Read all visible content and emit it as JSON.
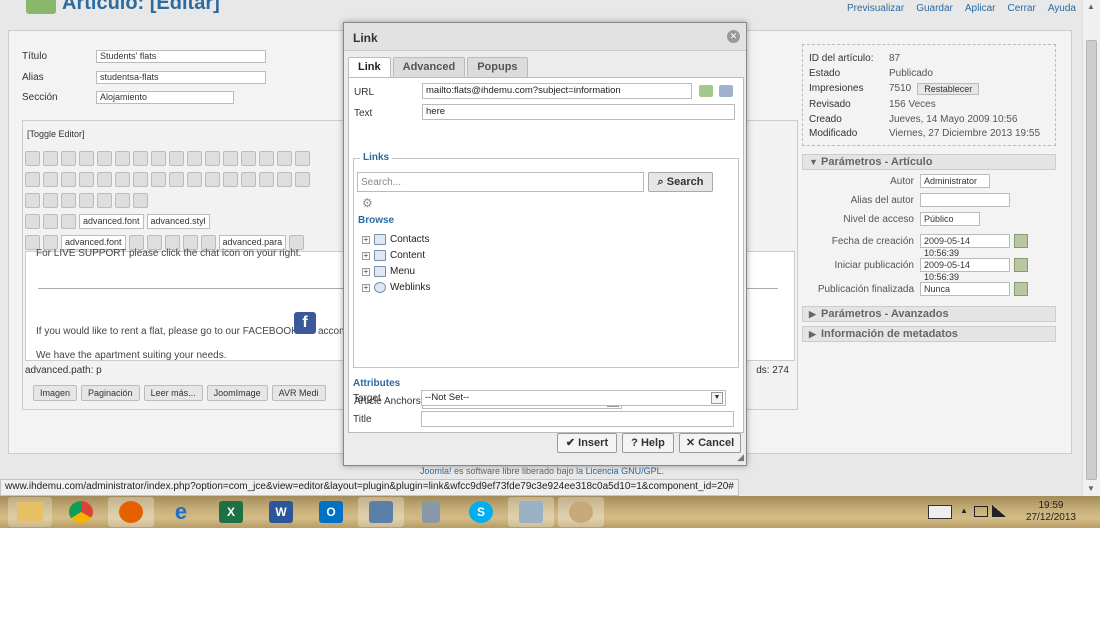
{
  "page": {
    "title": "Artículo: [Editar]"
  },
  "top_actions": [
    "Previsualizar",
    "Guardar",
    "Aplicar",
    "Cerrar",
    "Ayuda"
  ],
  "form": {
    "titulo_label": "Título",
    "titulo_value": "Students' flats",
    "alias_label": "Alias",
    "alias_value": "studentsa-flats",
    "seccion_label": "Sección",
    "seccion_value": "Alojamiento"
  },
  "editor": {
    "toggle_label": "[Toggle Editor]",
    "font_select": "advanced.font",
    "style_select": "advanced.styl",
    "font_select2": "advanced.font",
    "para_select": "advanced.para",
    "line1": "For LIVE SUPPORT please click the chat icon on your right.",
    "line2": "If you would like to rent a flat, please go to our FACEBOOK",
    "line2_tail": "accom",
    "line3": "We have the apartment suiting your needs.",
    "path": "advanced.path: p",
    "word_count": "ds: 274",
    "bottom_buttons": [
      "Imagen",
      "Paginación",
      "Leer más...",
      "JoomImage",
      "AVR Medi"
    ]
  },
  "info": {
    "rows": [
      {
        "k": "ID del artículo:",
        "v": "87"
      },
      {
        "k": "Estado",
        "v": "Publicado"
      },
      {
        "k": "Impresiones",
        "v": "7510"
      },
      {
        "k": "Revisado",
        "v": "156 Veces"
      },
      {
        "k": "Creado",
        "v": "Jueves, 14 Mayo 2009 10:56"
      },
      {
        "k": "Modificado",
        "v": "Viernes, 27 Diciembre 2013 19:55"
      }
    ],
    "reset_label": "Restablecer"
  },
  "params": {
    "header": "Parámetros - Artículo",
    "rows": [
      {
        "k": "Autor",
        "v": "Administrator"
      },
      {
        "k": "Alias del autor",
        "v": ""
      },
      {
        "k": "Nivel de acceso",
        "v": "Público"
      },
      {
        "k": "Fecha de creación",
        "v": "2009-05-14 10:56:39"
      },
      {
        "k": "Iniciar publicación",
        "v": "2009-05-14 10:56:39"
      },
      {
        "k": "Publicación finalizada",
        "v": "Nunca"
      }
    ],
    "advanced_header": "Parámetros - Avanzados",
    "meta_header": "Información de metadatos"
  },
  "footer": {
    "brand": "Joomla!",
    "text": " es software libre liberado bajo la ",
    "license": "Licencia GNU/GPL."
  },
  "status_url": "www.ihdemu.com/administrator/index.php?option=com_jce&view=editor&layout=plugin&plugin=link&wfcc9d9ef73fde79c3e924ee318c0a5d10=1&component_id=20#",
  "dialog": {
    "title": "Link",
    "tabs": [
      "Link",
      "Advanced",
      "Popups"
    ],
    "url_label": "URL",
    "url_value": "mailto:flats@ihdemu.com?subject=information",
    "text_label": "Text",
    "text_value": "here",
    "links_legend": "Links",
    "search_placeholder": "Search...",
    "search_button": "Search",
    "browse_label": "Browse",
    "tree": [
      "Contacts",
      "Content",
      "Menu",
      "Weblinks"
    ],
    "attributes_label": "Attributes",
    "anchors_label": "Article Anchors",
    "anchors_value": "---",
    "target_label": "Target",
    "target_value": "--Not Set--",
    "title_label": "Title",
    "title_value": "",
    "insert": "Insert",
    "help": "Help",
    "cancel": "Cancel"
  },
  "taskbar": {
    "time": "19:59",
    "date": "27/12/2013",
    "apps": [
      "explorer",
      "chrome",
      "firefox",
      "internet-explorer",
      "excel",
      "word",
      "outlook",
      "remote-desktop",
      "calculator",
      "skype",
      "app",
      "paint"
    ]
  }
}
